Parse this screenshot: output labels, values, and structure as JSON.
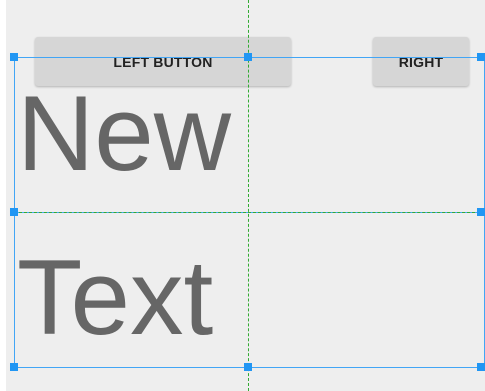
{
  "layout_editor": {
    "buttons": {
      "left_label": "LEFT BUTTON",
      "right_label": "RIGHT"
    },
    "texts": {
      "first": "New",
      "second": "Text"
    },
    "colors": {
      "canvas_bg": "#eeeeee",
      "button_bg": "#d6d6d6",
      "text_gray": "#666666",
      "selection_blue": "#2196f3",
      "guide_green": "#33aa33"
    }
  }
}
